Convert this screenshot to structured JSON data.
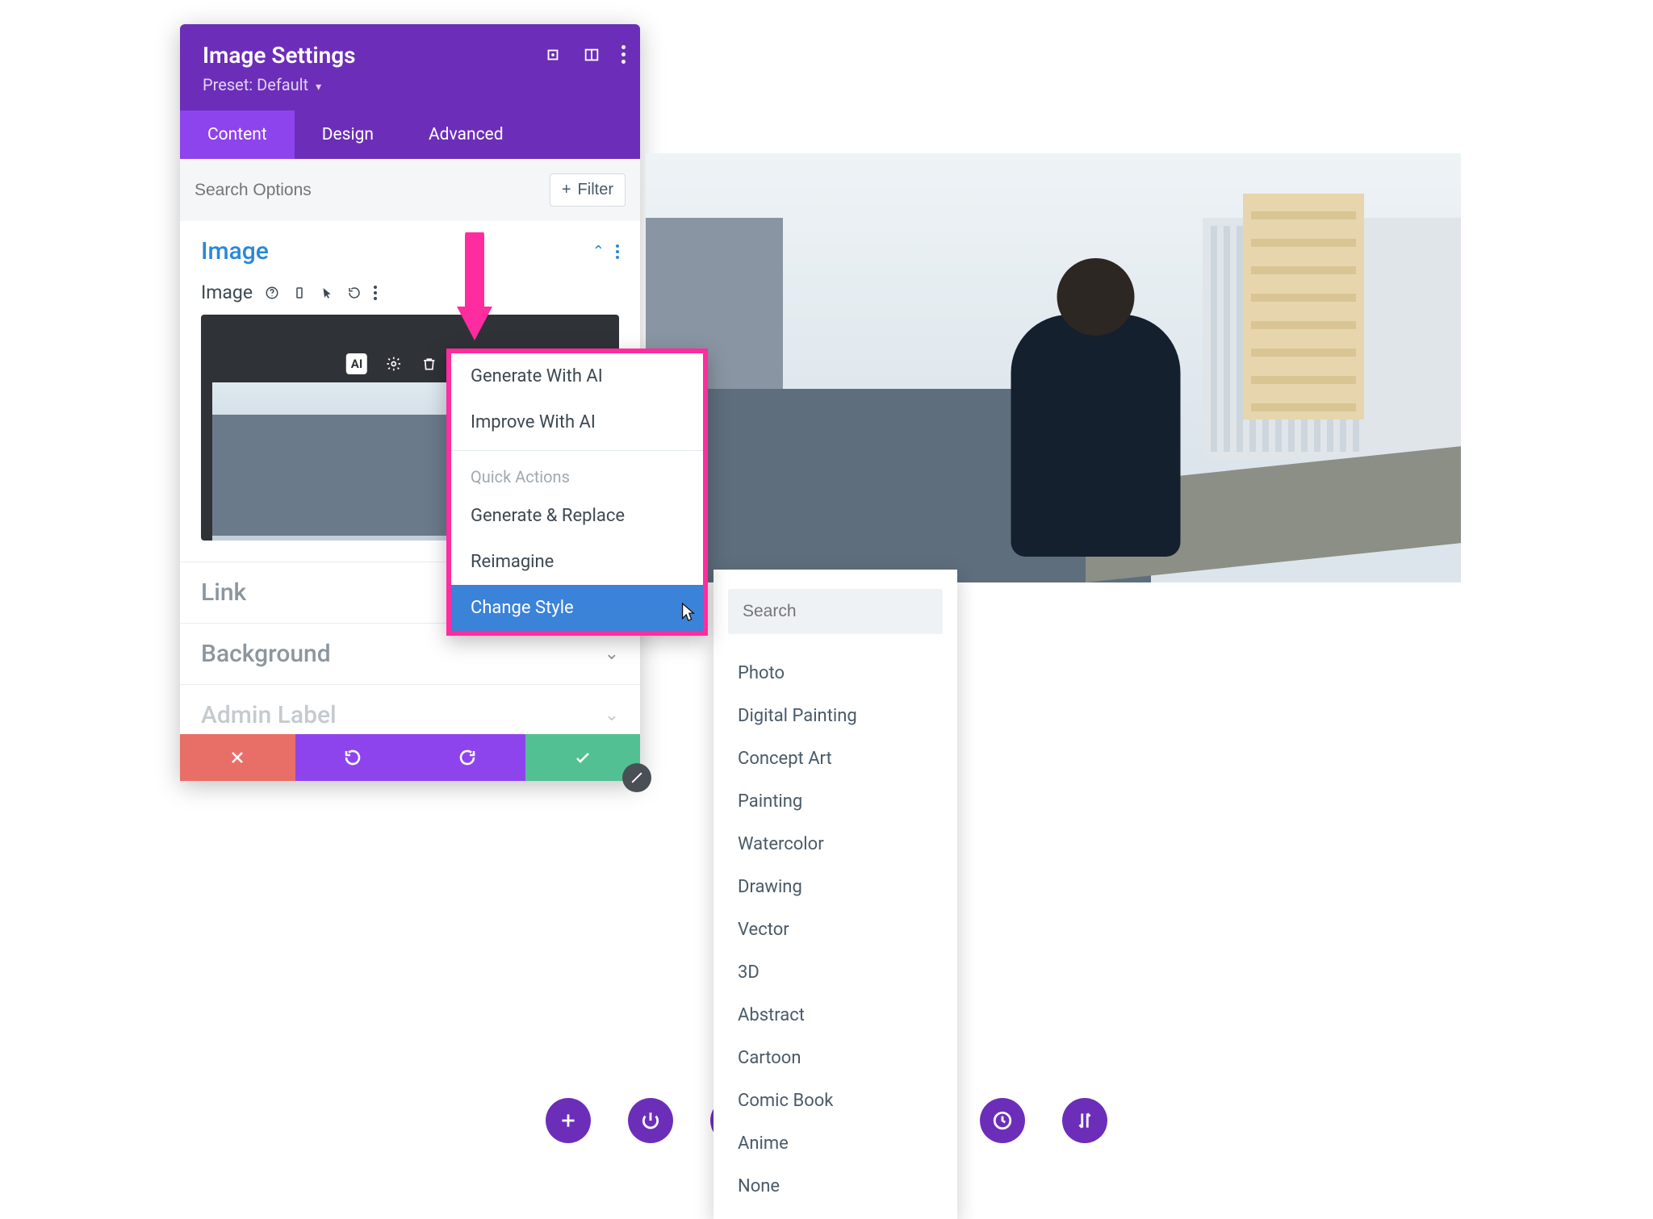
{
  "panel": {
    "title": "Image Settings",
    "preset_label": "Preset: Default",
    "tabs": {
      "content": "Content",
      "design": "Design",
      "advanced": "Advanced"
    },
    "search_placeholder": "Search Options",
    "filter_label": "Filter"
  },
  "sections": {
    "image_title": "Image",
    "image_field_label": "Image",
    "link_title": "Link",
    "background_title": "Background",
    "admin_title": "Admin Label"
  },
  "ai_toolbar": {
    "badge": "AI"
  },
  "ai_menu": {
    "generate": "Generate With AI",
    "improve": "Improve With AI",
    "quick_heading": "Quick Actions",
    "generate_replace": "Generate & Replace",
    "reimagine": "Reimagine",
    "change_style": "Change Style"
  },
  "style_dd": {
    "search_placeholder": "Search",
    "options": [
      "Photo",
      "Digital Painting",
      "Concept Art",
      "Painting",
      "Watercolor",
      "Drawing",
      "Vector",
      "3D",
      "Abstract",
      "Cartoon",
      "Comic Book",
      "Anime",
      "None"
    ]
  }
}
